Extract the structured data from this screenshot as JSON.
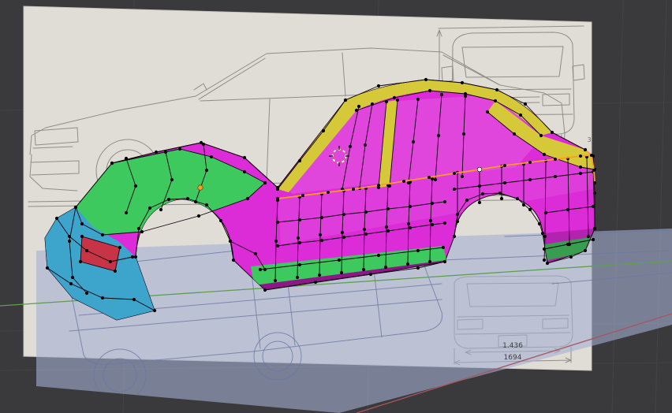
{
  "scene": {
    "type": "3d-viewport",
    "description": "polygon car body model in edit mode over car blueprint reference planes"
  },
  "viewport": {
    "background": "#3a393c",
    "grid_line": "#434347",
    "axis_x": "#a8555f",
    "axis_y": "#5c9f50"
  },
  "planes": {
    "blueprint": {
      "fill": "#e0ddd6",
      "edge": "#c9c6be",
      "line": "#8f8d86"
    },
    "floor": {
      "fill": "rgba(163,176,210,0.60)",
      "line": "#6a78a4"
    }
  },
  "mesh": {
    "body": "#dc2cd8",
    "hood": "#3ec95e",
    "cabin": "#d5c93a",
    "bumper": "#3da4cc",
    "headlight": "#c63446",
    "rocker": "#3ec95e",
    "wire": "#0d000d",
    "vertex": "#000000",
    "selection": "#ff9d1f",
    "active_vertex": "#ffffff",
    "origin": "#ff9d1f"
  },
  "cursor3d": {
    "ring": "#ffffff",
    "ring_alt": "#d8607e",
    "cross": "#1c1c1c"
  },
  "annotations": {
    "dim_primary": "1.436",
    "dim_secondary": "1694",
    "stray_digit": "3"
  }
}
